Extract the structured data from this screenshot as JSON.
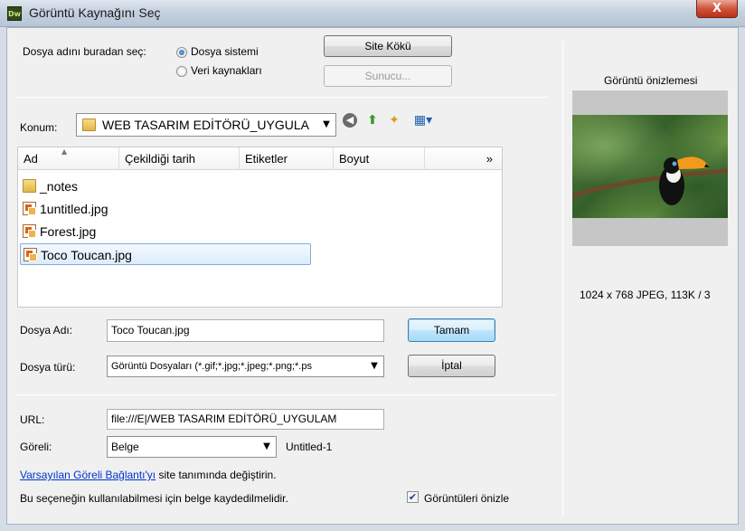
{
  "window": {
    "app_icon": "Dw",
    "title": "Görüntü Kaynağını Seç",
    "close": "X"
  },
  "select_from": {
    "label": "Dosya adını buradan seç:",
    "options": [
      "Dosya sistemi",
      "Veri kaynakları"
    ],
    "selected": "Dosya sistemi"
  },
  "buttons": {
    "site_root": "Site Kökü",
    "server": "Sunucu...",
    "ok": "Tamam",
    "cancel": "İptal"
  },
  "location": {
    "label": "Konum:",
    "value": "WEB TASARIM EDİTÖRÜ_UYGULA",
    "icons": [
      "back-icon",
      "up-folder-icon",
      "new-folder-icon",
      "view-menu-icon"
    ]
  },
  "file_list": {
    "columns": [
      "Ad",
      "Çekildiği tarih",
      "Etiketler",
      "Boyut",
      "»"
    ],
    "sorted_column": "Ad",
    "items": [
      {
        "name": "_notes",
        "type": "folder"
      },
      {
        "name": "1untitled.jpg",
        "type": "image"
      },
      {
        "name": "Forest.jpg",
        "type": "image"
      },
      {
        "name": "Toco Toucan.jpg",
        "type": "image"
      }
    ],
    "selected": "Toco Toucan.jpg"
  },
  "filename": {
    "label": "Dosya Adı:",
    "value": "Toco Toucan.jpg"
  },
  "filetype": {
    "label": "Dosya türü:",
    "value": "Görüntü Dosyaları (*.gif;*.jpg;*.jpeg;*.png;*.ps"
  },
  "url": {
    "label": "URL:",
    "value": "file:///E|/WEB TASARIM EDİTÖRÜ_UYGULAM"
  },
  "relative": {
    "label": "Göreli:",
    "value": "Belge",
    "doc_name": "Untitled-1"
  },
  "info": {
    "link_text": "Varsayılan Göreli Bağlantı'yı",
    "link_suffix": "site tanımında değiştirin.",
    "note": "Bu seçeneğin kullanılabilmesi için belge kaydedilmelidir."
  },
  "preview_check": {
    "label": "Görüntüleri önizle",
    "checked": true
  },
  "preview": {
    "title": "Görüntü önizlemesi",
    "info": "1024 x 768 JPEG, 113K / 3"
  }
}
